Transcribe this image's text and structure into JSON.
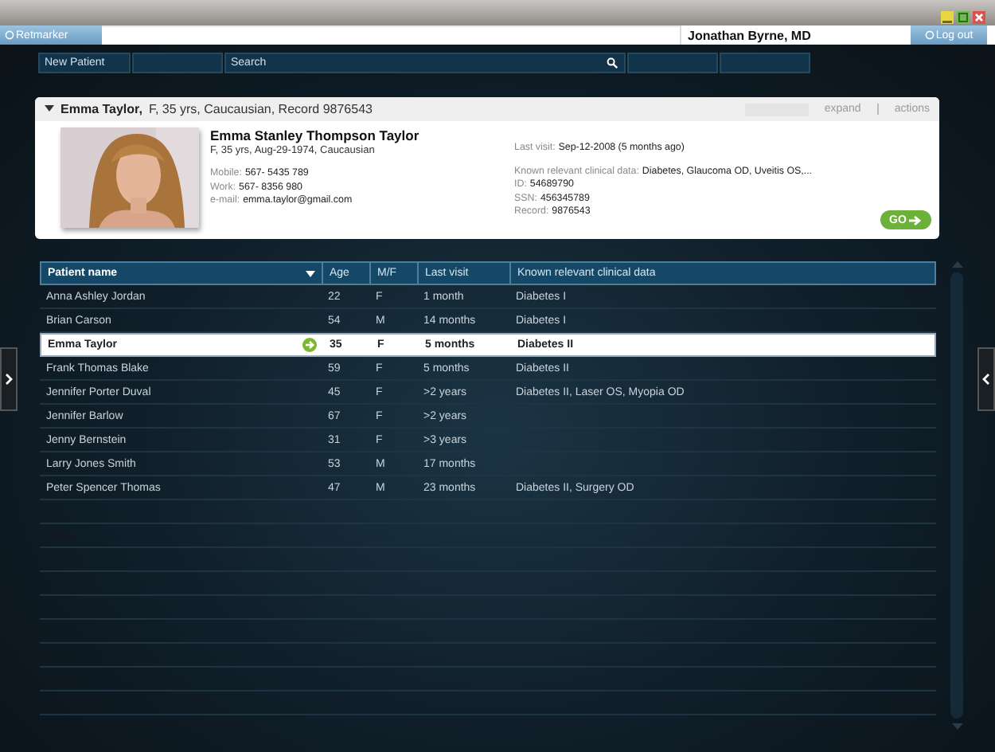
{
  "top_bar": {
    "logo_button": "Retmarker",
    "user": "Jonathan Byrne, MD",
    "logout_button": "Log out"
  },
  "toolbar": {
    "new_patient_button": "New Patient",
    "search": {
      "placeholder": "Search"
    }
  },
  "patient_card": {
    "expanded": true,
    "name": "Emma Taylor,",
    "summary": "F, 35 yrs, Caucausian, Record 9876543",
    "header_links": [
      "expand",
      "actions"
    ],
    "full_name": "Emma Stanley Thompson Taylor",
    "details": "F, 35 yrs,  Aug-29-1974, Caucausian",
    "contacts": [
      {
        "label": "Mobile:",
        "value": "567- 5435 789"
      },
      {
        "label": "Work:",
        "value": "567- 8356 980"
      },
      {
        "label": "e-mail:",
        "value": "emma.taylor@gmail.com"
      }
    ],
    "last_visit": {
      "label": "Last visit:",
      "value": "Sep-12-2008 (5 months ago)"
    },
    "clinical": {
      "label": "Known relevant clinical data:",
      "value": "Diabetes, Glaucoma OD, Uveitis OS,..."
    },
    "ids": [
      {
        "label": "ID:",
        "value": "54689790"
      },
      {
        "label": "SSN:",
        "value": "456345789"
      },
      {
        "label": "Record:",
        "value": "9876543"
      }
    ],
    "go_button": "GO"
  },
  "table": {
    "columns": [
      {
        "label": "Patient name",
        "sorted": true
      },
      {
        "label": "Age",
        "sorted": false
      },
      {
        "label": "M/F",
        "sorted": false
      },
      {
        "label": "Last visit",
        "sorted": false
      },
      {
        "label": "Known relevant clinical data",
        "sorted": false
      }
    ],
    "rows": [
      {
        "name": "Anna Ashley Jordan",
        "age": "22",
        "sex": "F",
        "last_visit": "1 month",
        "clinical": "Diabetes I",
        "selected": false
      },
      {
        "name": "Brian Carson",
        "age": "54",
        "sex": "M",
        "last_visit": "14 months",
        "clinical": "Diabetes I",
        "selected": false
      },
      {
        "name": "Emma Taylor",
        "age": "35",
        "sex": "F",
        "last_visit": "5 months",
        "clinical": "Diabetes II",
        "selected": true
      },
      {
        "name": "Frank Thomas Blake",
        "age": "59",
        "sex": "F",
        "last_visit": "5 months",
        "clinical": "Diabetes II",
        "selected": false
      },
      {
        "name": "Jennifer Porter Duval",
        "age": "45",
        "sex": "F",
        "last_visit": ">2 years",
        "clinical": "Diabetes II, Laser OS, Myopia OD",
        "selected": false
      },
      {
        "name": "Jennifer Barlow",
        "age": "67",
        "sex": "F",
        "last_visit": ">2 years",
        "selected": false
      },
      {
        "name": "Jenny Bernstein",
        "age": "31",
        "sex": "F",
        "last_visit": ">3 years",
        "selected": false
      },
      {
        "name": "Larry Jones Smith",
        "age": "53",
        "sex": "M",
        "last_visit": "17 months",
        "selected": false
      },
      {
        "name": "Peter Spencer Thomas",
        "age": "47",
        "sex": "M",
        "last_visit": "23 months",
        "clinical": "Diabetes II, Surgery OD",
        "selected": false
      }
    ]
  }
}
